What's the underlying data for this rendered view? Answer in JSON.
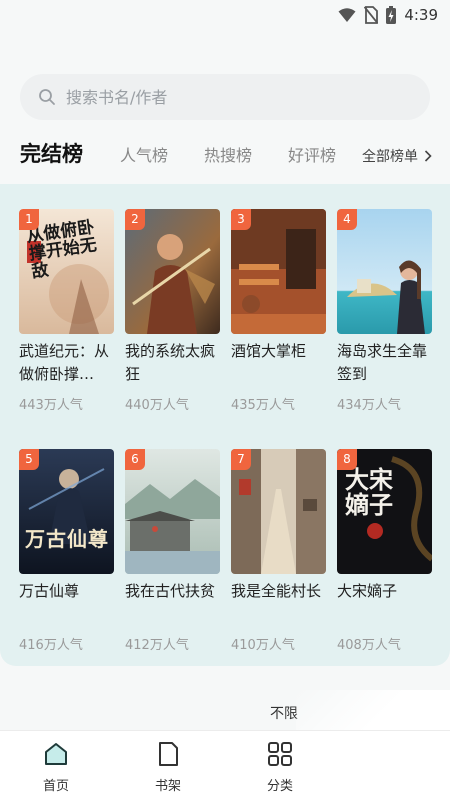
{
  "status_bar": {
    "time": "4:39",
    "icons": [
      "wifi-icon",
      "no-sim-icon",
      "battery-charging-icon"
    ]
  },
  "search": {
    "placeholder": "搜索书名/作者",
    "icon": "search-icon"
  },
  "rank_tabs": {
    "items": [
      {
        "label": "完结榜",
        "active": true
      },
      {
        "label": "人气榜",
        "active": false
      },
      {
        "label": "热搜榜",
        "active": false
      },
      {
        "label": "好评榜",
        "active": false
      }
    ],
    "all_label": "全部榜单",
    "all_icon": "chevron-right-icon"
  },
  "books": [
    {
      "rank": "1",
      "title": "武道纪元：从做俯卧撑…",
      "popularity": "443万人气"
    },
    {
      "rank": "2",
      "title": "我的系统太疯狂",
      "popularity": "440万人气"
    },
    {
      "rank": "3",
      "title": "酒馆大掌柜",
      "popularity": "435万人气"
    },
    {
      "rank": "4",
      "title": "海岛求生全靠签到",
      "popularity": "434万人气"
    },
    {
      "rank": "5",
      "title": "万古仙尊",
      "popularity": "416万人气"
    },
    {
      "rank": "6",
      "title": "我在古代扶贫",
      "popularity": "412万人气"
    },
    {
      "rank": "7",
      "title": "我是全能村长",
      "popularity": "410万人气"
    },
    {
      "rank": "8",
      "title": "大宋嫡子",
      "popularity": "408万人气"
    }
  ],
  "cover_texts": {
    "book1": "从做俯卧撑开始无敌",
    "book5": "万古仙尊",
    "book8": "大宋嫡子"
  },
  "promo": {
    "text": "不限"
  },
  "bottom_nav": [
    {
      "label": "首页",
      "icon": "home-icon",
      "active": true
    },
    {
      "label": "书架",
      "icon": "bookshelf-icon",
      "active": false
    },
    {
      "label": "分类",
      "icon": "category-grid-icon",
      "active": false
    }
  ],
  "colors": {
    "accent": "#2aa7a0",
    "rank_badge": "#f0653e",
    "panel_bg": "#e3f1f1"
  }
}
